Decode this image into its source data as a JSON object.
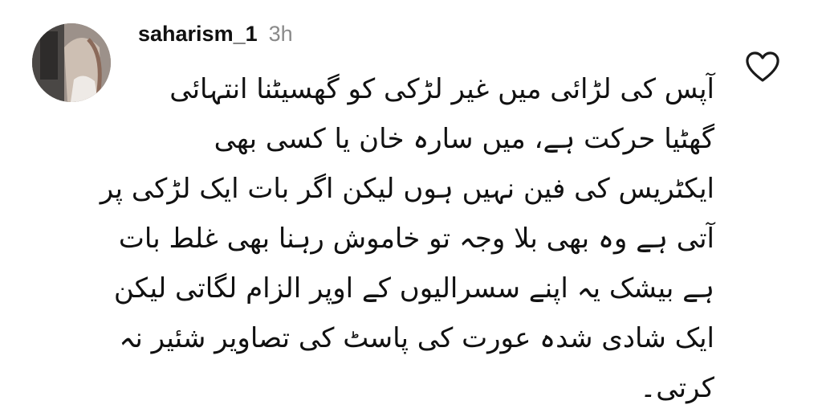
{
  "comment": {
    "username": "saharism_1",
    "timestamp": "3h",
    "lines": [
      "آپس کی لڑائی میں غیر لڑکی کو گھسیٹنا انتہائی",
      "گھٹیا حرکت ہے، میں سارہ خان یا کسی بھی",
      "ایکٹریس کی فین نہیں ہوں لیکن اگر بات ایک لڑکی پر",
      "آتی ہے وہ بھی بلا وجہ تو خاموش رہنا بھی غلط بات",
      "ہے بیشک یہ اپنے سسرالیوں  کے اوپر الزام لگاتی لیکن",
      "ایک شادی شدہ عورت کی پاسٹ کی تصاویر شئیر نہ",
      "کرتی۔"
    ]
  },
  "icons": {
    "like": "heart-outline-icon",
    "avatar": "user-avatar"
  },
  "colors": {
    "text": "#111111",
    "timestamp": "#8a8a8a",
    "icon": "#1a1a1a",
    "background": "#ffffff"
  }
}
